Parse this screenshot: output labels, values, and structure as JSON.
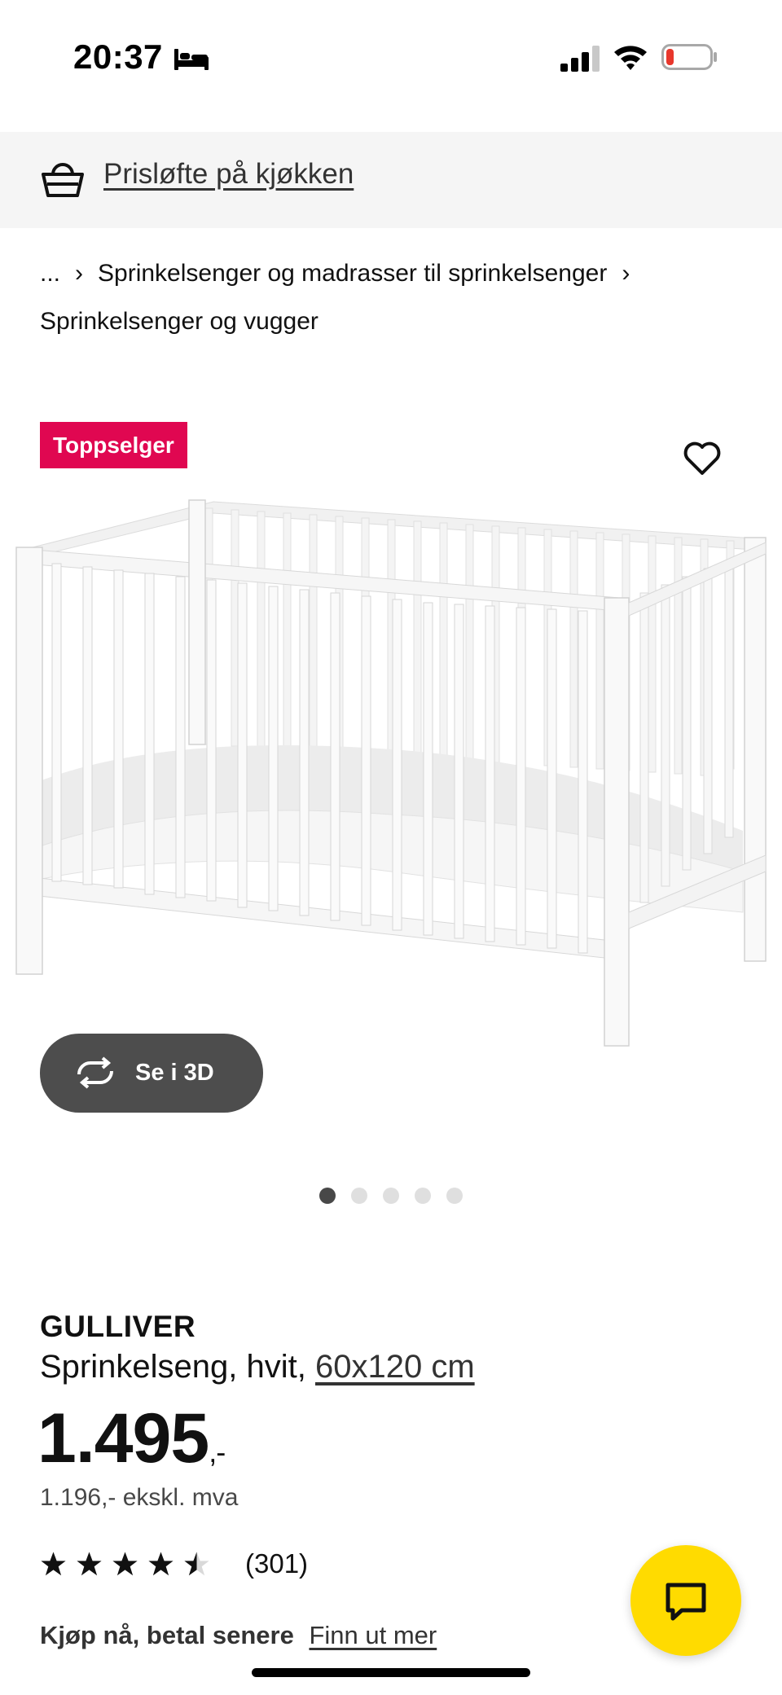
{
  "status_bar": {
    "time": "20:37",
    "icons": [
      "bed-icon",
      "cellular-signal-icon",
      "wifi-icon",
      "battery-low-icon"
    ]
  },
  "promo": {
    "icon": "basket-icon",
    "link_text": "Prisløfte på kjøkken"
  },
  "breadcrumb": {
    "items": [
      "...",
      "Sprinkelsenger og madrasser til sprinkelsenger",
      "Sprinkelsenger og vugger"
    ],
    "separator": "›"
  },
  "gallery": {
    "badge": "Toppselger",
    "favorite_icon": "heart-icon",
    "view3d_label": "Se i 3D",
    "pager": {
      "count": 5,
      "active_index": 0
    }
  },
  "product": {
    "name": "GULLIVER",
    "description_prefix": "Sprinkelseng, hvit,",
    "size": "60x120 cm",
    "price_main": "1.495",
    "price_suffix": ",-",
    "price_ex_vat": "1.196,- ekskl. mva",
    "rating_value": 4.5,
    "rating_max": 5,
    "review_count": "(301)"
  },
  "payment": {
    "label": "Kjøp nå, betal senere",
    "link": "Finn ut mer"
  },
  "colors": {
    "badge": "#e00751",
    "chat_button": "#ffdb00",
    "view3d_button": "#4d4d4d",
    "promo_background": "#f5f5f5"
  },
  "chat": {
    "icon": "chat-bubble-icon"
  }
}
